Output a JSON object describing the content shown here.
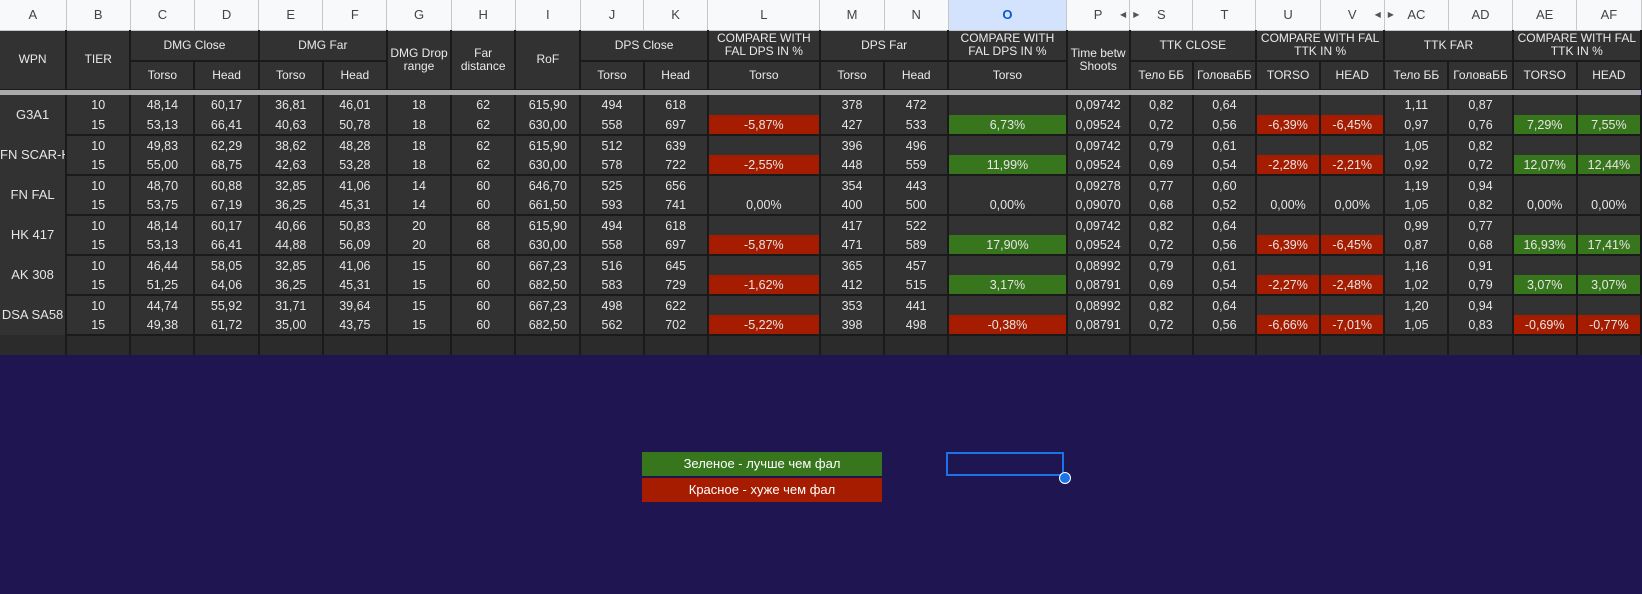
{
  "columns": [
    "A",
    "B",
    "C",
    "D",
    "E",
    "F",
    "G",
    "H",
    "I",
    "J",
    "K",
    "L",
    "M",
    "N",
    "O",
    "P",
    "S",
    "T",
    "U",
    "V",
    "AC",
    "AD",
    "AE",
    "AF"
  ],
  "headers": {
    "wpn": "WPN",
    "tier": "TIER",
    "dmg_close": "DMG Close",
    "dmg_far": "DMG Far",
    "dmg_drop": "DMG Drop range",
    "far_distance": "Far distance",
    "rof": "RoF",
    "dps_close": "DPS Close",
    "cmp_dps_l": "COMPARE WITH FAL DPS IN %",
    "dps_far": "DPS Far",
    "cmp_dps_o": "COMPARE WITH FAL DPS IN %",
    "time_betw": "Time betw Shoots",
    "ttk_close": "TTK CLOSE",
    "cmp_ttk_uv": "COMPARE WITH FAL TTK IN %",
    "ttk_far": "TTK FAR",
    "cmp_ttk_aeaf": "COMPARE WITH FAL TTK IN %"
  },
  "subheaders": [
    "Torso",
    "Head",
    "Torso",
    "Head",
    "Torso",
    "Head",
    "Torso",
    "Torso",
    "Head",
    "Torso",
    "Тело ББ",
    "ГоловаББ",
    "TORSO",
    "HEAD",
    "Тело ББ",
    "ГоловаББ",
    "TORSO",
    "HEAD"
  ],
  "weapons": [
    {
      "name": "G3A1",
      "rows": [
        {
          "tier": "10",
          "c": "48,14",
          "d": "60,17",
          "e": "36,81",
          "f": "46,01",
          "g": "18",
          "h": "62",
          "i": "615,90",
          "j": "494",
          "k": "618",
          "l": "",
          "m": "378",
          "n": "472",
          "o": "",
          "p": "0,09742",
          "s": "0,82",
          "t": "0,64",
          "u": "",
          "v": "",
          "ac": "1,11",
          "ad": "0,87",
          "ae": "",
          "af": ""
        },
        {
          "tier": "15",
          "c": "53,13",
          "d": "66,41",
          "e": "40,63",
          "f": "50,78",
          "g": "18",
          "h": "62",
          "i": "630,00",
          "j": "558",
          "k": "697",
          "l": "-5,87%",
          "m": "427",
          "n": "533",
          "o": "6,73%",
          "p": "0,09524",
          "s": "0,72",
          "t": "0,56",
          "u": "-6,39%",
          "v": "-6,45%",
          "ac": "0,97",
          "ad": "0,76",
          "ae": "7,29%",
          "af": "7,55%"
        }
      ]
    },
    {
      "name": "FN SCAR-H",
      "rows": [
        {
          "tier": "10",
          "c": "49,83",
          "d": "62,29",
          "e": "38,62",
          "f": "48,28",
          "g": "18",
          "h": "62",
          "i": "615,90",
          "j": "512",
          "k": "639",
          "l": "",
          "m": "396",
          "n": "496",
          "o": "",
          "p": "0,09742",
          "s": "0,79",
          "t": "0,61",
          "u": "",
          "v": "",
          "ac": "1,05",
          "ad": "0,82",
          "ae": "",
          "af": ""
        },
        {
          "tier": "15",
          "c": "55,00",
          "d": "68,75",
          "e": "42,63",
          "f": "53,28",
          "g": "18",
          "h": "62",
          "i": "630,00",
          "j": "578",
          "k": "722",
          "l": "-2,55%",
          "m": "448",
          "n": "559",
          "o": "11,99%",
          "p": "0,09524",
          "s": "0,69",
          "t": "0,54",
          "u": "-2,28%",
          "v": "-2,21%",
          "ac": "0,92",
          "ad": "0,72",
          "ae": "12,07%",
          "af": "12,44%"
        }
      ]
    },
    {
      "name": "FN FAL",
      "rows": [
        {
          "tier": "10",
          "c": "48,70",
          "d": "60,88",
          "e": "32,85",
          "f": "41,06",
          "g": "14",
          "h": "60",
          "i": "646,70",
          "j": "525",
          "k": "656",
          "l": "",
          "m": "354",
          "n": "443",
          "o": "",
          "p": "0,09278",
          "s": "0,77",
          "t": "0,60",
          "u": "",
          "v": "",
          "ac": "1,19",
          "ad": "0,94",
          "ae": "",
          "af": ""
        },
        {
          "tier": "15",
          "c": "53,75",
          "d": "67,19",
          "e": "36,25",
          "f": "45,31",
          "g": "14",
          "h": "60",
          "i": "661,50",
          "j": "593",
          "k": "741",
          "l": "0,00%",
          "m": "400",
          "n": "500",
          "o": "0,00%",
          "p": "0,09070",
          "s": "0,68",
          "t": "0,52",
          "u": "0,00%",
          "v": "0,00%",
          "ac": "1,05",
          "ad": "0,82",
          "ae": "0,00%",
          "af": "0,00%"
        }
      ]
    },
    {
      "name": "HK 417",
      "rows": [
        {
          "tier": "10",
          "c": "48,14",
          "d": "60,17",
          "e": "40,66",
          "f": "50,83",
          "g": "20",
          "h": "68",
          "i": "615,90",
          "j": "494",
          "k": "618",
          "l": "",
          "m": "417",
          "n": "522",
          "o": "",
          "p": "0,09742",
          "s": "0,82",
          "t": "0,64",
          "u": "",
          "v": "",
          "ac": "0,99",
          "ad": "0,77",
          "ae": "",
          "af": ""
        },
        {
          "tier": "15",
          "c": "53,13",
          "d": "66,41",
          "e": "44,88",
          "f": "56,09",
          "g": "20",
          "h": "68",
          "i": "630,00",
          "j": "558",
          "k": "697",
          "l": "-5,87%",
          "m": "471",
          "n": "589",
          "o": "17,90%",
          "p": "0,09524",
          "s": "0,72",
          "t": "0,56",
          "u": "-6,39%",
          "v": "-6,45%",
          "ac": "0,87",
          "ad": "0,68",
          "ae": "16,93%",
          "af": "17,41%"
        }
      ]
    },
    {
      "name": "AK 308",
      "rows": [
        {
          "tier": "10",
          "c": "46,44",
          "d": "58,05",
          "e": "32,85",
          "f": "41,06",
          "g": "15",
          "h": "60",
          "i": "667,23",
          "j": "516",
          "k": "645",
          "l": "",
          "m": "365",
          "n": "457",
          "o": "",
          "p": "0,08992",
          "s": "0,79",
          "t": "0,61",
          "u": "",
          "v": "",
          "ac": "1,16",
          "ad": "0,91",
          "ae": "",
          "af": ""
        },
        {
          "tier": "15",
          "c": "51,25",
          "d": "64,06",
          "e": "36,25",
          "f": "45,31",
          "g": "15",
          "h": "60",
          "i": "682,50",
          "j": "583",
          "k": "729",
          "l": "-1,62%",
          "m": "412",
          "n": "515",
          "o": "3,17%",
          "p": "0,08791",
          "s": "0,69",
          "t": "0,54",
          "u": "-2,27%",
          "v": "-2,48%",
          "ac": "1,02",
          "ad": "0,79",
          "ae": "3,07%",
          "af": "3,07%"
        }
      ]
    },
    {
      "name": "DSA SA58",
      "rows": [
        {
          "tier": "10",
          "c": "44,74",
          "d": "55,92",
          "e": "31,71",
          "f": "39,64",
          "g": "15",
          "h": "60",
          "i": "667,23",
          "j": "498",
          "k": "622",
          "l": "",
          "m": "353",
          "n": "441",
          "o": "",
          "p": "0,08992",
          "s": "0,82",
          "t": "0,64",
          "u": "",
          "v": "",
          "ac": "1,20",
          "ad": "0,94",
          "ae": "",
          "af": ""
        },
        {
          "tier": "15",
          "c": "49,38",
          "d": "61,72",
          "e": "35,00",
          "f": "43,75",
          "g": "15",
          "h": "60",
          "i": "682,50",
          "j": "562",
          "k": "702",
          "l": "-5,22%",
          "m": "398",
          "n": "498",
          "o": "-0,38%",
          "p": "0,08791",
          "s": "0,72",
          "t": "0,56",
          "u": "-6,66%",
          "v": "-7,01%",
          "ac": "1,05",
          "ad": "0,83",
          "ae": "-0,69%",
          "af": "-0,77%"
        }
      ]
    }
  ],
  "legend": {
    "green_text": "Зеленое - лучше чем фал",
    "red_text": "Красное - хуже чем фал"
  },
  "colors": {
    "green": "#38761d",
    "red": "#a61c00",
    "background": "#1f1550",
    "cell": "#323232"
  },
  "selected_column": "O"
}
